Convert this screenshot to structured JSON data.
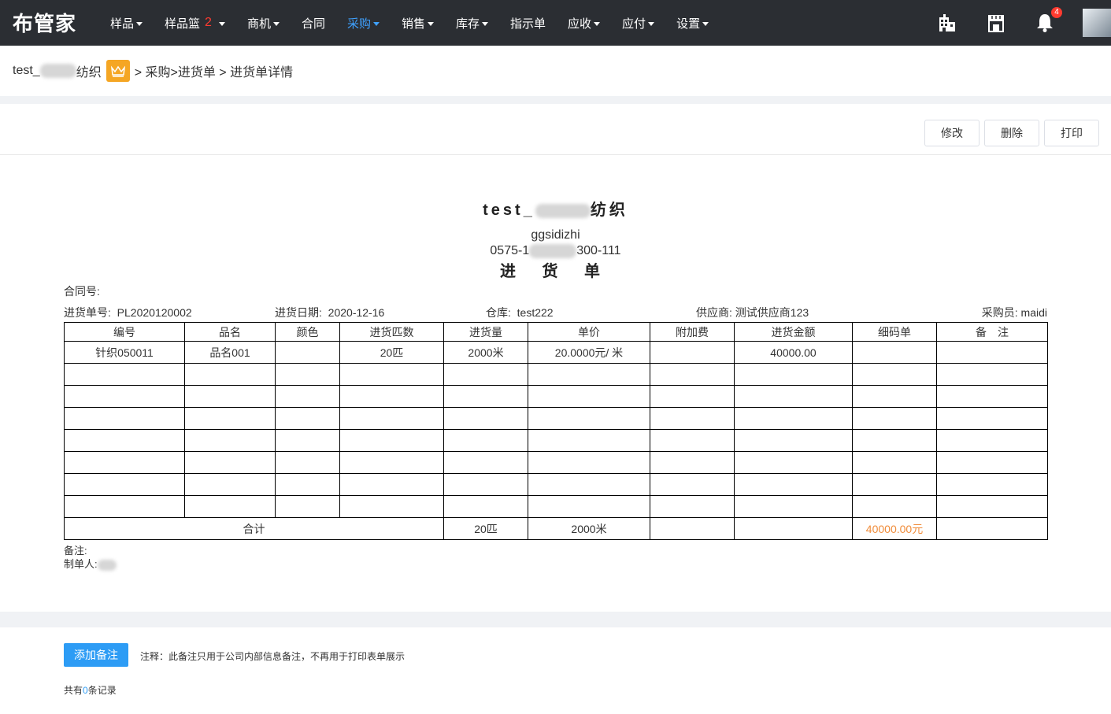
{
  "app": {
    "logo": "布管家"
  },
  "nav": [
    {
      "label": "样品",
      "caret": true
    },
    {
      "label": "样品篮",
      "badge": "2",
      "caret": true
    },
    {
      "label": "商机",
      "caret": true
    },
    {
      "label": "合同",
      "caret": false
    },
    {
      "label": "采购",
      "caret": true,
      "active": true
    },
    {
      "label": "销售",
      "caret": true
    },
    {
      "label": "库存",
      "caret": true
    },
    {
      "label": "指示单",
      "caret": false
    },
    {
      "label": "应收",
      "caret": true
    },
    {
      "label": "应付",
      "caret": true
    },
    {
      "label": "设置",
      "caret": true
    }
  ],
  "top_icons": {
    "notification_count": "4"
  },
  "breadcrumb": {
    "company_prefix": "test_",
    "company_suffix": "纺织",
    "path": "> 采购>进货单 > 进货单详情"
  },
  "toolbar": {
    "edit": "修改",
    "delete": "删除",
    "print": "打印"
  },
  "doc": {
    "company_prefix": "test_",
    "company_suffix": "纺织",
    "address": "ggsidizhi",
    "phone_prefix": "0575-1",
    "phone_suffix": "300-111",
    "heading": "进 货 单",
    "contract_label": "合同号:",
    "order_no_label": "进货单号:",
    "order_no": "PL2020120002",
    "date_label": "进货日期:",
    "date": "2020-12-16",
    "warehouse_label": "仓库:",
    "warehouse": "test222",
    "supplier_label": "供应商:",
    "supplier": "测试供应商123",
    "buyer_label": "采购员:",
    "buyer": "maidi"
  },
  "table": {
    "headers": [
      "编号",
      "品名",
      "颜色",
      "进货匹数",
      "进货量",
      "单价",
      "附加费",
      "进货金额",
      "细码单",
      "备　注"
    ],
    "rows": [
      [
        "针织050011",
        "品名001",
        "",
        "20匹",
        "2000米",
        "20.0000元/ 米",
        "",
        "40000.00",
        "",
        ""
      ],
      [
        "",
        "",
        "",
        "",
        "",
        "",
        "",
        "",
        "",
        ""
      ],
      [
        "",
        "",
        "",
        "",
        "",
        "",
        "",
        "",
        "",
        ""
      ],
      [
        "",
        "",
        "",
        "",
        "",
        "",
        "",
        "",
        "",
        ""
      ],
      [
        "",
        "",
        "",
        "",
        "",
        "",
        "",
        "",
        "",
        ""
      ],
      [
        "",
        "",
        "",
        "",
        "",
        "",
        "",
        "",
        "",
        ""
      ],
      [
        "",
        "",
        "",
        "",
        "",
        "",
        "",
        "",
        "",
        ""
      ],
      [
        "",
        "",
        "",
        "",
        "",
        "",
        "",
        "",
        "",
        ""
      ]
    ],
    "total_label": "合计",
    "total_pieces": "20匹",
    "total_qty": "2000米",
    "total_amount": "40000.00元"
  },
  "footer": {
    "remark_label": "备注:",
    "maker_label": "制单人:"
  },
  "bottom": {
    "add_remark": "添加备注",
    "hint": "注释：此备注只用于公司内部信息备注，不再用于打印表单展示",
    "count_prefix": "共有",
    "count": "0",
    "count_suffix": "条记录"
  },
  "colors": {
    "topbar": "#2b2e33",
    "active": "#3fa1ff",
    "primary": "#2d9cf5",
    "orange": "#f08c3a",
    "crown": "#f5a623"
  }
}
